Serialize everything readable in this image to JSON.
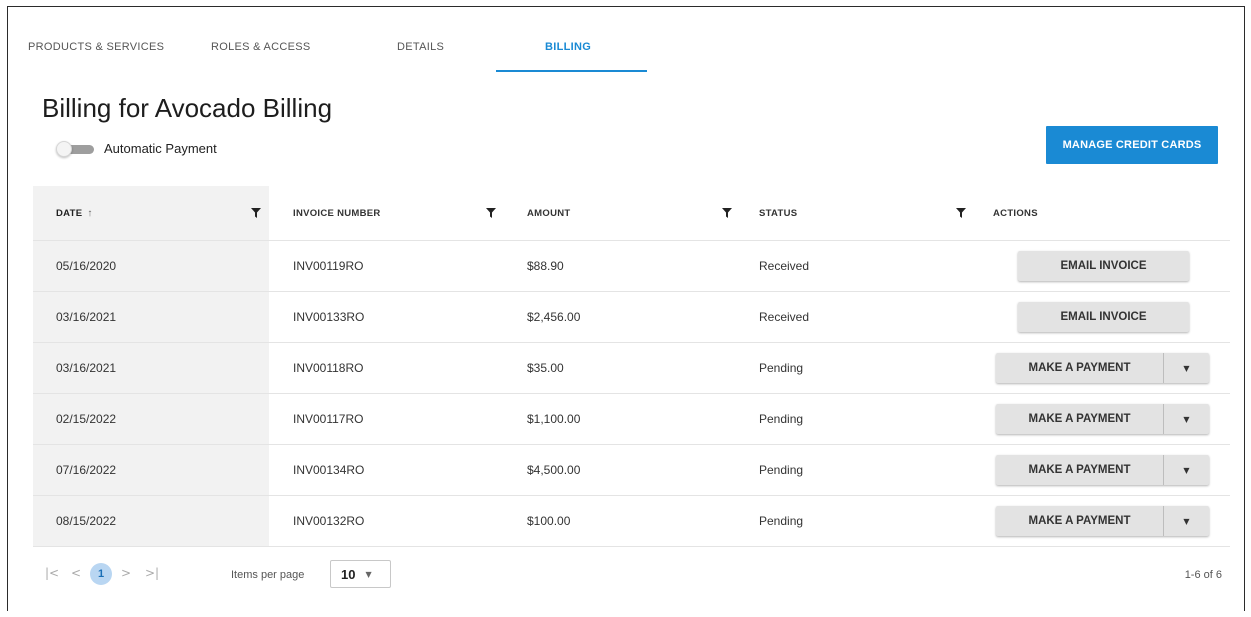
{
  "tabs": [
    {
      "label": "PRODUCTS & SERVICES",
      "active": false
    },
    {
      "label": "ROLES & ACCESS",
      "active": false
    },
    {
      "label": "DETAILS",
      "active": false
    },
    {
      "label": "BILLING",
      "active": true
    }
  ],
  "page": {
    "title": "Billing for Avocado Billing",
    "auto_payment_label": "Automatic Payment",
    "auto_payment_on": false,
    "manage_cards_label": "MANAGE CREDIT CARDS"
  },
  "table": {
    "columns": [
      "DATE",
      "INVOICE NUMBER",
      "AMOUNT",
      "STATUS",
      "ACTIONS"
    ],
    "sort_indicator": "↑",
    "rows": [
      {
        "date": "05/16/2020",
        "invoice": "INV00119RO",
        "amount": "$88.90",
        "status": "Received",
        "action": "EMAIL INVOICE"
      },
      {
        "date": "03/16/2021",
        "invoice": "INV00133RO",
        "amount": "$2,456.00",
        "status": "Received",
        "action": "EMAIL INVOICE"
      },
      {
        "date": "03/16/2021",
        "invoice": "INV00118RO",
        "amount": "$35.00",
        "status": "Pending",
        "action": "MAKE A PAYMENT"
      },
      {
        "date": "02/15/2022",
        "invoice": "INV00117RO",
        "amount": "$1,100.00",
        "status": "Pending",
        "action": "MAKE A PAYMENT"
      },
      {
        "date": "07/16/2022",
        "invoice": "INV00134RO",
        "amount": "$4,500.00",
        "status": "Pending",
        "action": "MAKE A PAYMENT"
      },
      {
        "date": "08/15/2022",
        "invoice": "INV00132RO",
        "amount": "$100.00",
        "status": "Pending",
        "action": "MAKE A PAYMENT"
      }
    ]
  },
  "pager": {
    "first": "|<",
    "prev": "<",
    "current_page": "1",
    "next": ">",
    "last": ">|",
    "items_per_page_label": "Items per page",
    "items_per_page": "10",
    "range_info": "1-6 of 6"
  },
  "colors": {
    "accent": "#1a8ad4",
    "button_gray": "#e3e3e3",
    "date_column_bg": "#f2f2f2",
    "current_page_bg": "#b9d6f2"
  },
  "icons": {
    "filter": "filter-funnel-icon",
    "dropdown": "caret-down-icon"
  }
}
